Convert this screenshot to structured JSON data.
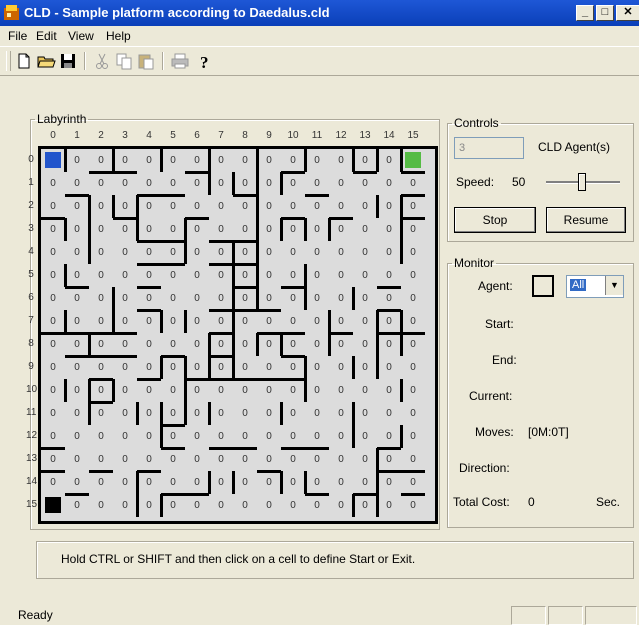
{
  "window": {
    "title": "CLD - Sample platform according to Daedalus.cld"
  },
  "menu": [
    {
      "label": "File"
    },
    {
      "label": "Edit"
    },
    {
      "label": "View"
    },
    {
      "label": "Help"
    }
  ],
  "toolbar": {
    "icons": [
      "new-file-icon",
      "open-folder-icon",
      "save-icon",
      "cut-icon",
      "copy-icon",
      "paste-icon",
      "print-icon",
      "help-icon"
    ]
  },
  "labyrinth": {
    "title": "Labyrinth",
    "columns": [
      "0",
      "1",
      "2",
      "3",
      "4",
      "5",
      "6",
      "7",
      "8",
      "9",
      "10",
      "11",
      "12",
      "13",
      "14",
      "15"
    ],
    "rows": [
      "0",
      "1",
      "2",
      "3",
      "4",
      "5",
      "6",
      "7",
      "8",
      "9",
      "10",
      "11",
      "12",
      "13",
      "14",
      "15"
    ],
    "cell_value": "0",
    "start_color": "#2255cc",
    "exit_color": "#55bb44",
    "blocked_color": "#000000"
  },
  "controls": {
    "title": "Controls",
    "agent_count": "3",
    "agent_label": "CLD Agent(s)",
    "speed_label": "Speed:",
    "speed_value": "50",
    "stop_label": "Stop",
    "resume_label": "Resume"
  },
  "monitor": {
    "title": "Monitor",
    "agent_label": "Agent:",
    "agent_select": "All",
    "start_label": "Start:",
    "end_label": "End:",
    "current_label": "Current:",
    "moves_label": "Moves:",
    "moves_value": "[0M:0T]",
    "direction_label": "Direction:",
    "total_cost_label": "Total Cost:",
    "total_cost_value": "0",
    "sec_label": "Sec."
  },
  "hint": "Hold CTRL or SHIFT and then click on a cell to define Start or Exit.",
  "status": {
    "text": "Ready"
  }
}
